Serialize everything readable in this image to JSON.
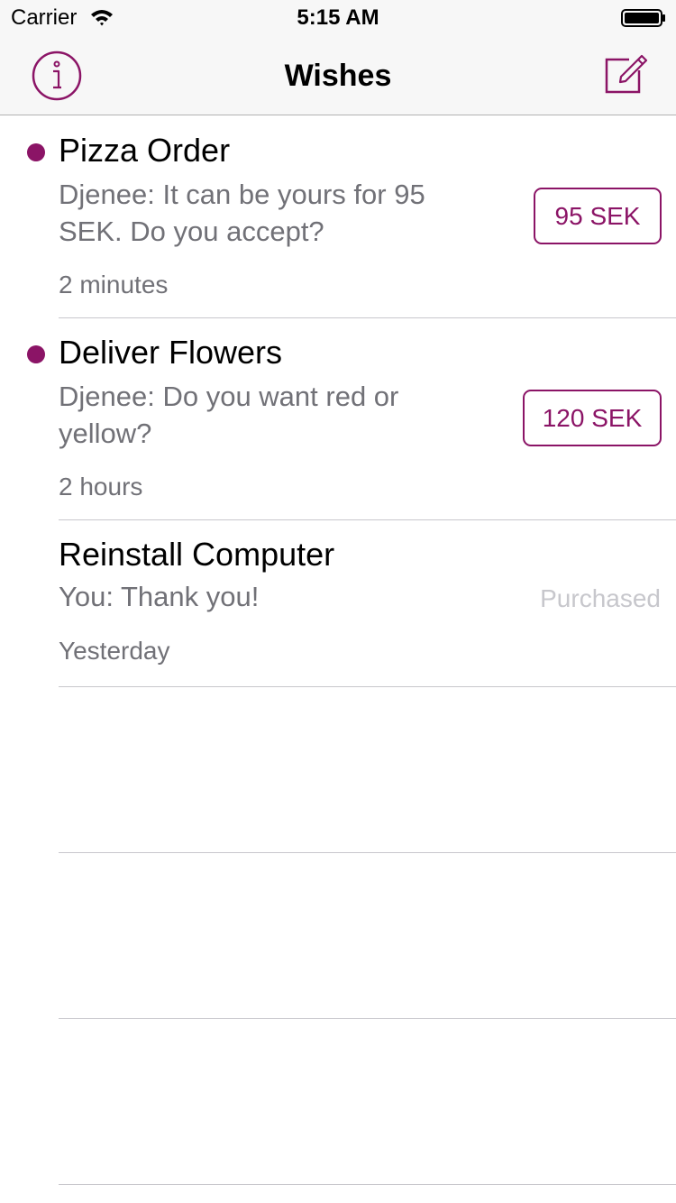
{
  "status_bar": {
    "carrier": "Carrier",
    "time": "5:15 AM"
  },
  "nav": {
    "title": "Wishes",
    "left_icon": "info-icon",
    "right_icon": "compose-icon"
  },
  "colors": {
    "accent": "#8b1466",
    "secondary_text": "#717177",
    "muted_text": "#c7c7cc"
  },
  "wishes": [
    {
      "title": "Pizza Order",
      "message": "Djenee: It can be yours for 95 SEK. Do you accept?",
      "time": "2 minutes",
      "price": "95 SEK",
      "unread": true
    },
    {
      "title": "Deliver Flowers",
      "message": "Djenee: Do you want red or yellow?",
      "time": "2 hours",
      "price": "120 SEK",
      "unread": true
    },
    {
      "title": "Reinstall Computer",
      "message": "You: Thank you!",
      "time": "Yesterday",
      "status": "Purchased",
      "unread": false
    }
  ]
}
